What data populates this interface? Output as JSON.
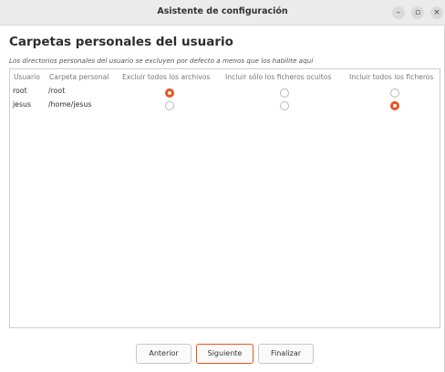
{
  "window": {
    "title": "Asistente de configuración"
  },
  "page": {
    "heading": "Carpetas personales del usuario",
    "subtitle": "Los directorios personales del usuario se excluyen por defecto a menos que los habilite aquí"
  },
  "table": {
    "headers": {
      "user": "Usuario",
      "home": "Carpeta personal",
      "exclude_all": "Excluir todos los archivos",
      "hidden_only": "Incluir sólo los ficheros ocultos",
      "include_all": "Incluir todos los ficheros"
    },
    "rows": [
      {
        "user": "root",
        "home": "/root",
        "selected": "exclude_all"
      },
      {
        "user": "jesus",
        "home": "/home/jesus",
        "selected": "include_all"
      }
    ]
  },
  "buttons": {
    "back": "Anterior",
    "next": "Siguiente",
    "finish": "Finalizar"
  },
  "colors": {
    "accent": "#e95420"
  }
}
